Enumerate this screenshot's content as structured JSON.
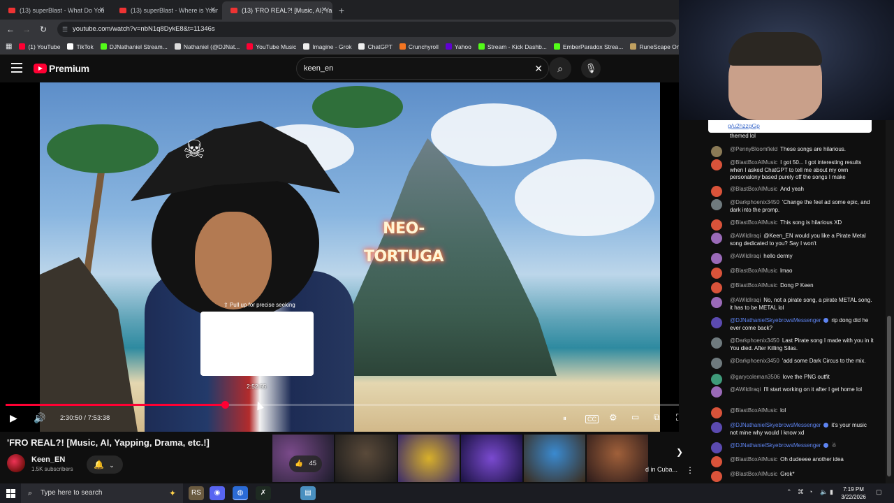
{
  "browser": {
    "tabs": [
      {
        "title": "(13) superBlast - What Do You",
        "active": false
      },
      {
        "title": "(13) superBlast - Where is Your",
        "active": false
      },
      {
        "title": "(13) 'FRO REAL?! [Music, AI, Yap",
        "active": true
      }
    ],
    "new_tab_symbol": "+",
    "close_symbol": "✕",
    "url": "youtube.com/watch?v=nbN1q8DykE8&t=11346s",
    "bookmarks": [
      {
        "label": "(1) YouTube",
        "color": "#ff0033"
      },
      {
        "label": "TikTok",
        "color": "#ffffff"
      },
      {
        "label": "DJNathaniel Stream...",
        "color": "#53fc18"
      },
      {
        "label": "Nathaniel (@DJNat...",
        "color": "#dddddd"
      },
      {
        "label": "YouTube Music",
        "color": "#ff0033"
      },
      {
        "label": "Imagine - Grok",
        "color": "#eeeeee"
      },
      {
        "label": "ChatGPT",
        "color": "#eeeeee"
      },
      {
        "label": "Crunchyroll",
        "color": "#f47521"
      },
      {
        "label": "Yahoo",
        "color": "#6001d2"
      },
      {
        "label": "Stream - Kick Dashb...",
        "color": "#53fc18"
      },
      {
        "label": "EmberParadox Strea...",
        "color": "#53fc18"
      },
      {
        "label": "RuneScape Online",
        "color": "#c0a060"
      }
    ]
  },
  "youtube": {
    "logo_text": "Premium",
    "search_value": "keen_en",
    "brand_color": "#ff0033"
  },
  "player": {
    "neon_sign": "NEO-TORTUGA",
    "seek_hint": "⇧ Pull up for precise seeking",
    "seek_preview_time": "2:52:55",
    "current_time": "2:30:50",
    "duration": "7:53:38",
    "time_display": "2:30:50 / 7:53:38",
    "progress_fraction": 0.318,
    "hover_fraction": 0.365
  },
  "video": {
    "title": "'FRO REAL?! [Music, AI, Yapping, Drama, etc.!]",
    "channel": "Keen_EN",
    "subscribers": "1.5K subscribers",
    "likes": "45",
    "related_snippet": "d in Cuba..."
  },
  "chat": {
    "pinned_link": "g/u2hzzgGp",
    "pinned_continuation": "themed lol",
    "messages": [
      {
        "author": "@PennyBloomfield",
        "text": "These songs are hilarious.",
        "avatar": "#8a7a56"
      },
      {
        "author": "@BlastBoxAIMusic",
        "text": "I got 50... I got interesting results when I asked ChatGPT to tell me about my own personalony based purely off the songs I make",
        "avatar": "#d9533a"
      },
      {
        "author": "@BlastBoxAIMusic",
        "text": "And yeah",
        "avatar": "#d9533a"
      },
      {
        "author": "@Darkphoenix3450",
        "text": "'Change the feel ad some epic, and dark into the promp.",
        "avatar": "#6f7a7e"
      },
      {
        "author": "@BlastBoxAIMusic",
        "text": "This song is hilarious XD",
        "avatar": "#d9533a"
      },
      {
        "author": "@AWildIraqi",
        "text": "@Keen_EN would you like a Pirate Metal song dedicated to you? Say I won't",
        "avatar": "#9a6ab8"
      },
      {
        "author": "@AWildIraqi",
        "text": "hello dermy",
        "avatar": "#9a6ab8"
      },
      {
        "author": "@BlastBoxAIMusic",
        "text": "lmao",
        "avatar": "#d9533a"
      },
      {
        "author": "@BlastBoxAIMusic",
        "text": "Dong P Keen",
        "avatar": "#d9533a"
      },
      {
        "author": "@AWildIraqi",
        "text": "No, not a pirate song, a pirate METAL song. it has to be METAL lol",
        "avatar": "#9a6ab8"
      },
      {
        "author": "@DJNathanielSkyebrowsMessenger",
        "text": "rip dong did he ever come back?",
        "avatar": "#5b4ab0",
        "mod": true
      },
      {
        "author": "@Darkphoenix3450",
        "text": "Last Pirate song I made with you in it You died. After Killing Silas.",
        "avatar": "#6f7a7e"
      },
      {
        "author": "@Darkphoenix3450",
        "text": "'add some Dark Circus to the mix.",
        "avatar": "#6f7a7e"
      },
      {
        "author": "@garycoleman3506",
        "text": "love the PNG outfit",
        "avatar": "#3f9a7a"
      },
      {
        "author": "@AWildIraqi",
        "text": "I'll start working on it after I get home lol",
        "avatar": "#9a6ab8"
      },
      {
        "author": "@BlastBoxAIMusic",
        "text": "lol",
        "avatar": "#d9533a"
      },
      {
        "author": "@DJNathanielSkyebrowsMessenger",
        "text": "it's your music not mine why would I know xd",
        "avatar": "#5b4ab0",
        "mod": true
      },
      {
        "author": "@DJNathanielSkyebrowsMessenger",
        "text": "",
        "avatar": "#5b4ab0",
        "mod": true
      },
      {
        "author": "@BlastBoxAIMusic",
        "text": "Oh dudeeee another idea",
        "avatar": "#d9533a"
      },
      {
        "author": "@BlastBoxAIMusic",
        "text": "Grok*",
        "avatar": "#d9533a"
      }
    ]
  },
  "taskbar": {
    "search_placeholder": "Type here to search",
    "time": "7:19 PM",
    "date": "3/22/2026"
  }
}
